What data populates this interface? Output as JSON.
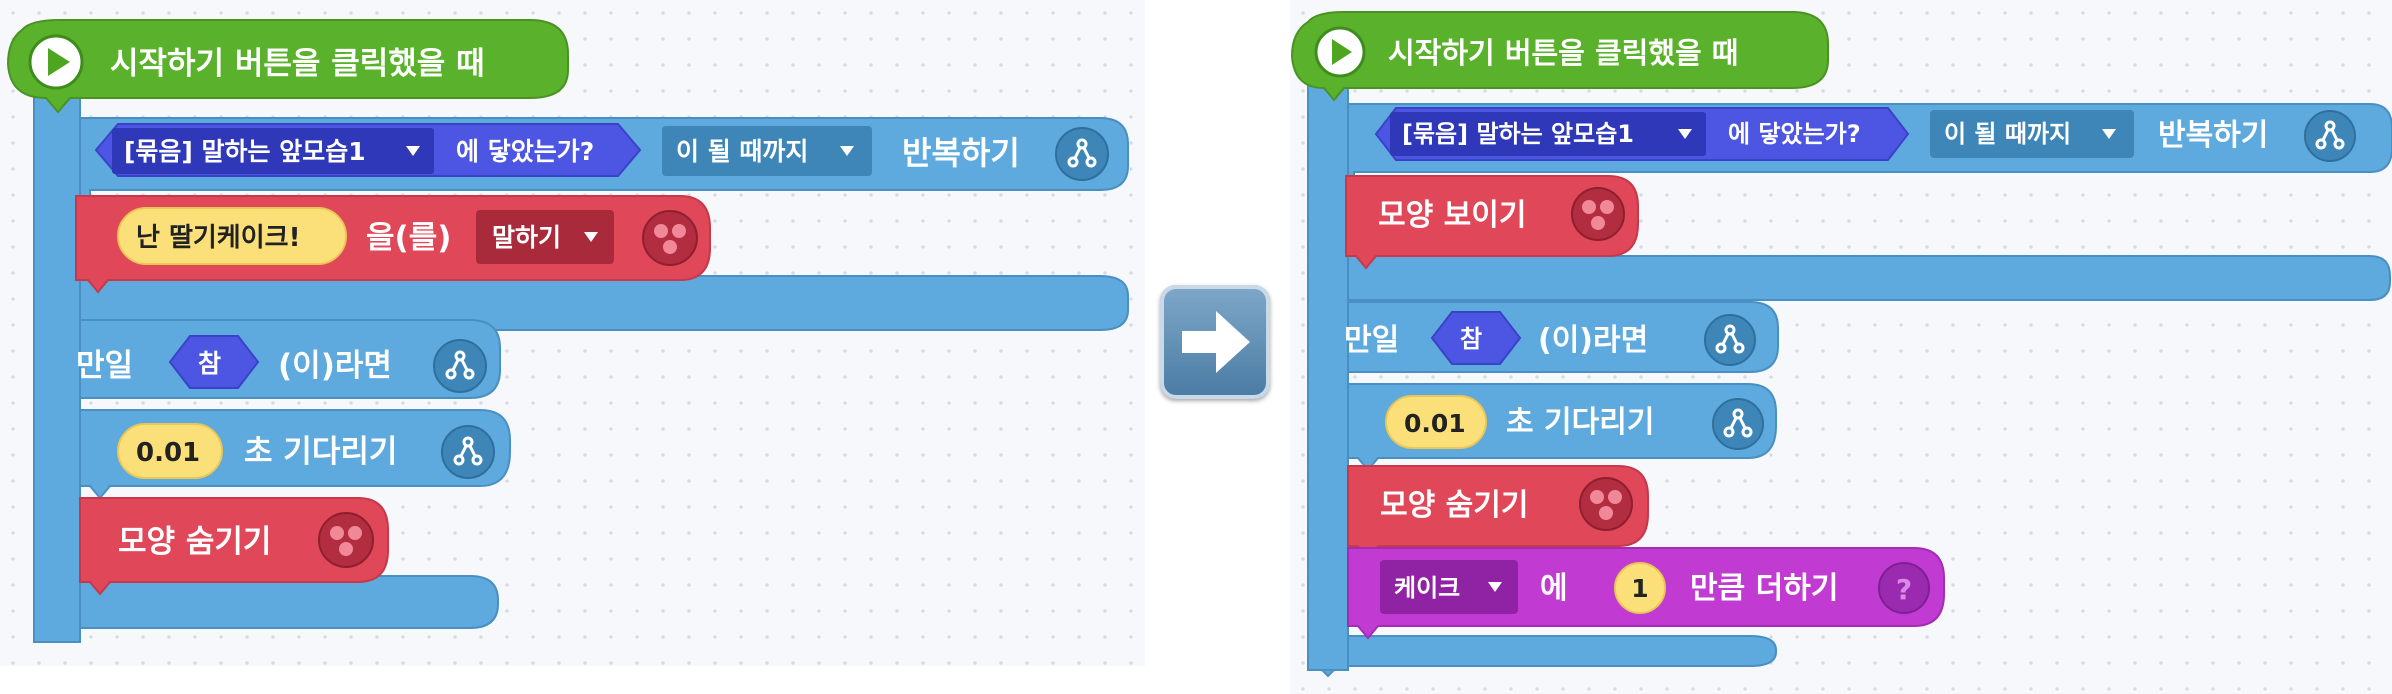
{
  "before": {
    "hat_label": "시작하기 버튼을 클릭했을 때",
    "repeat": {
      "object_dropdown": "[묶음] 말하는 앞모습1",
      "touch_label": "에 닿았는가?",
      "mode_dropdown": "이 될 때까지",
      "label": "반복하기"
    },
    "say": {
      "text": "난 딸기케이크!",
      "particle": "을(를)",
      "mode_dropdown": "말하기"
    },
    "if": {
      "prefix": "만일",
      "condition": "참",
      "suffix": "(이)라면"
    },
    "wait": {
      "seconds": "0.01",
      "label": "초 기다리기"
    },
    "hide_label": "모양 숨기기"
  },
  "after": {
    "hat_label": "시작하기 버튼을 클릭했을 때",
    "repeat": {
      "object_dropdown": "[묶음] 말하는 앞모습1",
      "touch_label": "에 닿았는가?",
      "mode_dropdown": "이 될 때까지",
      "label": "반복하기"
    },
    "show_label": "모양 보이기",
    "if": {
      "prefix": "만일",
      "condition": "참",
      "suffix": "(이)라면"
    },
    "wait": {
      "seconds": "0.01",
      "label": "초 기다리기"
    },
    "hide_label": "모양 숨기기",
    "add": {
      "variable_dropdown": "케이크",
      "particle": "에",
      "value": "1",
      "label": "만큼 더하기"
    }
  },
  "icons": {
    "play": "play-icon",
    "flow": "flow-icon",
    "looks": "looks-icon",
    "help": "question-icon",
    "dropdown": "dropdown-caret-icon",
    "next": "right-arrow-icon"
  },
  "colors": {
    "start": "#5ab22c",
    "flow": "#5ea9dd",
    "looks": "#e04759",
    "judge": "#4c56e3",
    "variable": "#c13bd3",
    "number": "#fbe07a"
  }
}
